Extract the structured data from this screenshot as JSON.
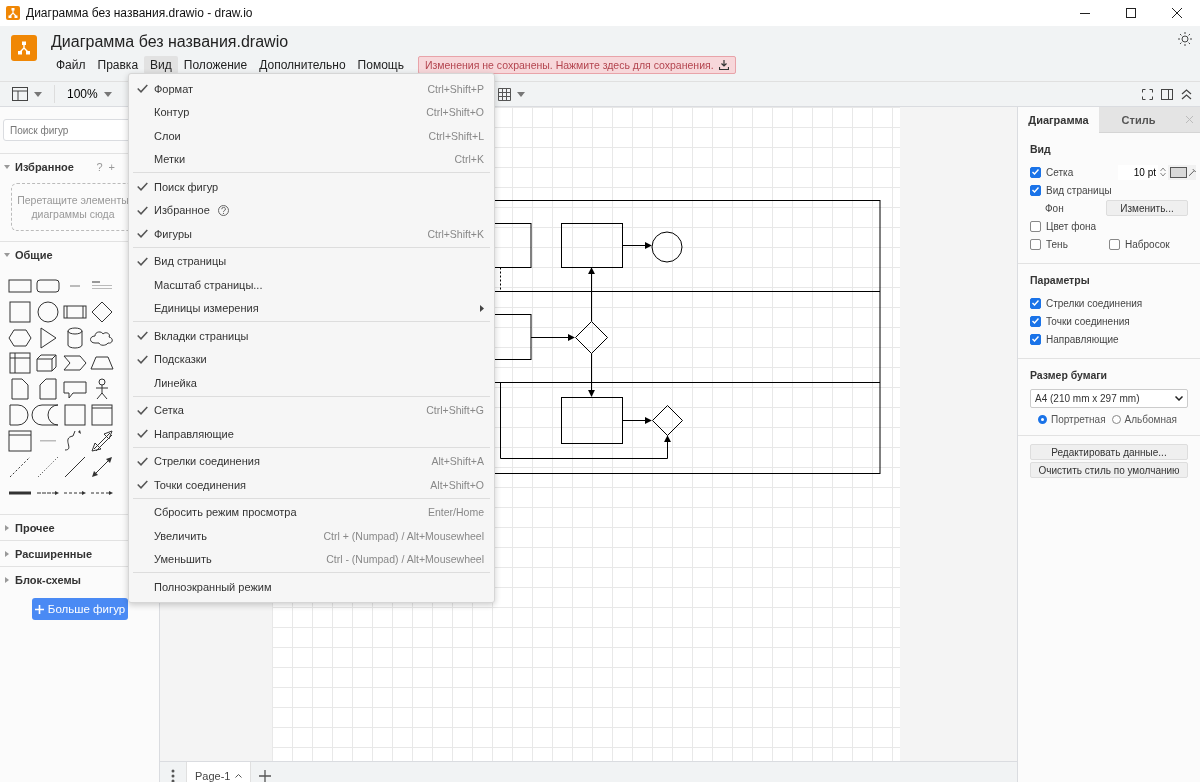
{
  "window": {
    "title": "Диаграмма без названия.drawio - draw.io"
  },
  "app": {
    "file_name": "Диаграмма без названия.drawio"
  },
  "menu_bar": [
    {
      "label": "Файл",
      "selected": false
    },
    {
      "label": "Правка",
      "selected": false
    },
    {
      "label": "Вид",
      "selected": true
    },
    {
      "label": "Положение",
      "selected": false
    },
    {
      "label": "Дополнительно",
      "selected": false
    },
    {
      "label": "Помощь",
      "selected": false
    }
  ],
  "unsaved_notice": "Изменения не сохранены. Нажмите здесь для сохранения.",
  "toolbar": {
    "zoom": "100%"
  },
  "view_menu": {
    "groups": [
      {
        "items": [
          {
            "label": "Формат",
            "shortcut": "Ctrl+Shift+P",
            "checked": true,
            "kind": "plain"
          },
          {
            "label": "Контур",
            "shortcut": "Ctrl+Shift+O",
            "checked": false,
            "kind": "plain"
          },
          {
            "label": "Слои",
            "shortcut": "Ctrl+Shift+L",
            "checked": false,
            "kind": "plain"
          },
          {
            "label": "Метки",
            "shortcut": "Ctrl+K",
            "checked": false,
            "kind": "plain"
          }
        ]
      },
      {
        "items": [
          {
            "label": "Поиск фигур",
            "checked": true,
            "kind": "plain"
          },
          {
            "label": "Избранное",
            "checked": true,
            "kind": "help"
          },
          {
            "label": "Фигуры",
            "shortcut": "Ctrl+Shift+K",
            "checked": true,
            "kind": "plain"
          }
        ]
      },
      {
        "items": [
          {
            "label": "Вид страницы",
            "checked": true,
            "kind": "plain"
          },
          {
            "label": "Масштаб страницы...",
            "checked": false,
            "kind": "plain"
          },
          {
            "label": "Единицы измерения",
            "checked": false,
            "kind": "submenu"
          }
        ]
      },
      {
        "items": [
          {
            "label": "Вкладки страницы",
            "checked": true,
            "kind": "plain"
          },
          {
            "label": "Подсказки",
            "checked": true,
            "kind": "plain"
          },
          {
            "label": "Линейка",
            "checked": false,
            "kind": "plain"
          }
        ]
      },
      {
        "items": [
          {
            "label": "Сетка",
            "shortcut": "Ctrl+Shift+G",
            "checked": true,
            "kind": "plain"
          },
          {
            "label": "Направляющие",
            "checked": true,
            "kind": "plain"
          }
        ]
      },
      {
        "items": [
          {
            "label": "Стрелки соединения",
            "shortcut": "Alt+Shift+A",
            "checked": true,
            "kind": "plain"
          },
          {
            "label": "Точки соединения",
            "shortcut": "Alt+Shift+O",
            "checked": true,
            "kind": "plain"
          }
        ]
      },
      {
        "items": [
          {
            "label": "Сбросить режим просмотра",
            "shortcut": "Enter/Home",
            "checked": false,
            "kind": "plain"
          },
          {
            "label": "Увеличить",
            "shortcut": "Ctrl + (Numpad) / Alt+Mousewheel",
            "checked": false,
            "kind": "plain"
          },
          {
            "label": "Уменьшить",
            "shortcut": "Ctrl - (Numpad) / Alt+Mousewheel",
            "checked": false,
            "kind": "plain"
          }
        ]
      },
      {
        "items": [
          {
            "label": "Полноэкранный режим",
            "checked": false,
            "kind": "plain"
          }
        ]
      }
    ]
  },
  "sidebar": {
    "search_placeholder": "Поиск фигур",
    "sections": [
      {
        "title": "Избранное",
        "expanded": true,
        "kind": "favorites",
        "actions": [
          "?",
          "+"
        ],
        "hint": "Перетащите элементы диаграммы сюда"
      },
      {
        "title": "Общие",
        "expanded": true,
        "kind": "shapes"
      },
      {
        "title": "Прочее",
        "expanded": false,
        "kind": "collapsed"
      },
      {
        "title": "Расширенные",
        "expanded": false,
        "kind": "collapsed"
      },
      {
        "title": "Блок-схемы",
        "expanded": false,
        "kind": "collapsed"
      }
    ],
    "more_shapes_button": "Больше фигур"
  },
  "format_panel": {
    "tabs": [
      {
        "label": "Диаграмма",
        "selected": true
      },
      {
        "label": "Стиль",
        "selected": false
      }
    ],
    "view": {
      "title": "Вид",
      "grid": {
        "label": "Сетка",
        "checked": true,
        "size": "10 pt"
      },
      "page_view": {
        "label": "Вид страницы",
        "checked": true
      },
      "background": {
        "label": "Фон",
        "button": "Изменить..."
      },
      "background_color": {
        "label": "Цвет фона",
        "checked": false
      },
      "shadow": {
        "label": "Тень",
        "checked": false
      },
      "sketch": {
        "label": "Набросок",
        "checked": false
      }
    },
    "options": {
      "title": "Параметры",
      "items": [
        {
          "label": "Стрелки соединения",
          "checked": true
        },
        {
          "label": "Точки соединения",
          "checked": true
        },
        {
          "label": "Направляющие",
          "checked": true
        }
      ]
    },
    "paper": {
      "title": "Размер бумаги",
      "size": "A4 (210 mm x 297 mm)",
      "orientations": [
        {
          "label": "Портретная",
          "selected": true
        },
        {
          "label": "Альбомная",
          "selected": false
        }
      ]
    },
    "buttons": [
      "Редактировать данные...",
      "Очистить стиль по умолчанию"
    ]
  },
  "pages": [
    {
      "label": "Page-1",
      "selected": true
    }
  ]
}
